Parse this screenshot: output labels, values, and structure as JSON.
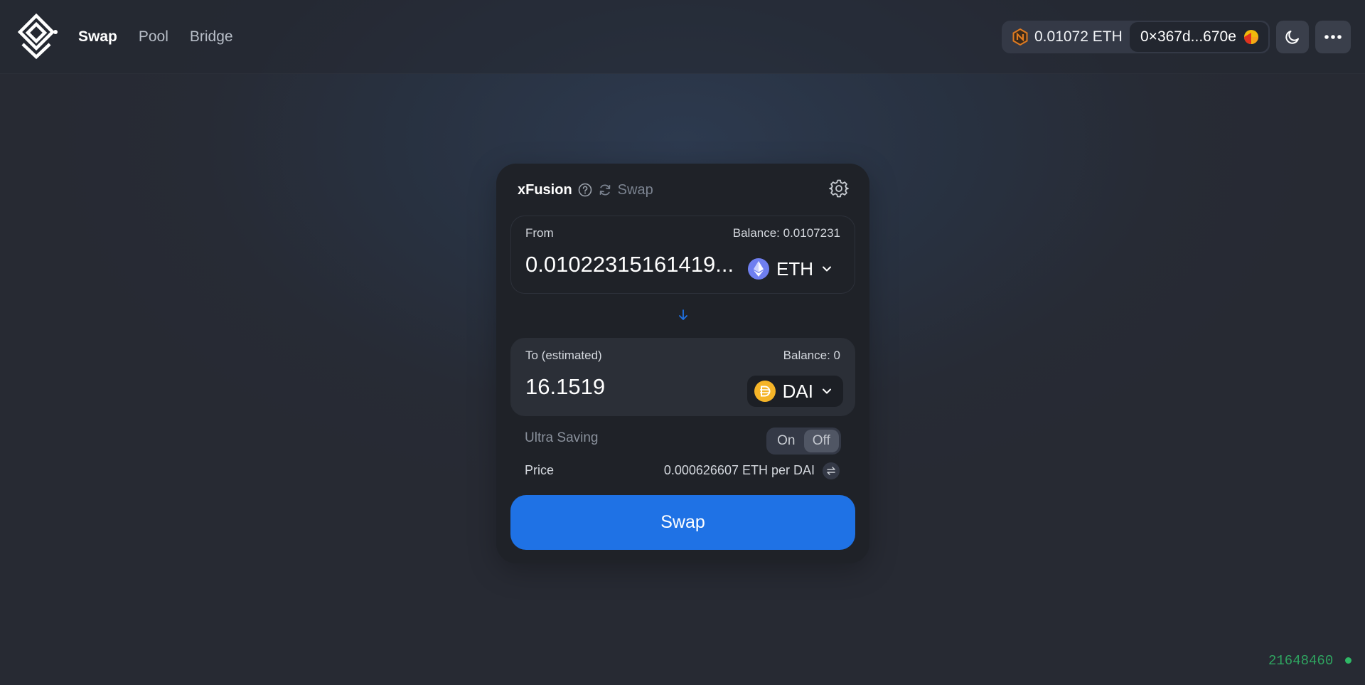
{
  "nav": {
    "items": [
      {
        "label": "Swap",
        "active": true
      },
      {
        "label": "Pool",
        "active": false
      },
      {
        "label": "Bridge",
        "active": false
      }
    ]
  },
  "wallet": {
    "balance": "0.01072 ETH",
    "address": "0×367d...670e"
  },
  "swap": {
    "brand": "xFusion",
    "title": "Swap",
    "from": {
      "label": "From",
      "balance": "Balance: 0.0107231",
      "amount": "0.01022315161419...",
      "token": "ETH"
    },
    "to": {
      "label": "To (estimated)",
      "balance": "Balance: 0",
      "amount": "16.1519",
      "token": "DAI"
    },
    "ultra_saving": {
      "label": "Ultra Saving",
      "on_label": "On",
      "off_label": "Off",
      "selected": "Off"
    },
    "price": {
      "label": "Price",
      "value": "0.000626607 ETH per DAI"
    },
    "button_label": "Swap"
  },
  "status": {
    "block_number": "21648460"
  },
  "colors": {
    "accent": "#1f72e5",
    "eth_token": "#6f7ff0",
    "dai_token": "#f5b428",
    "status_green": "#2fb866"
  }
}
